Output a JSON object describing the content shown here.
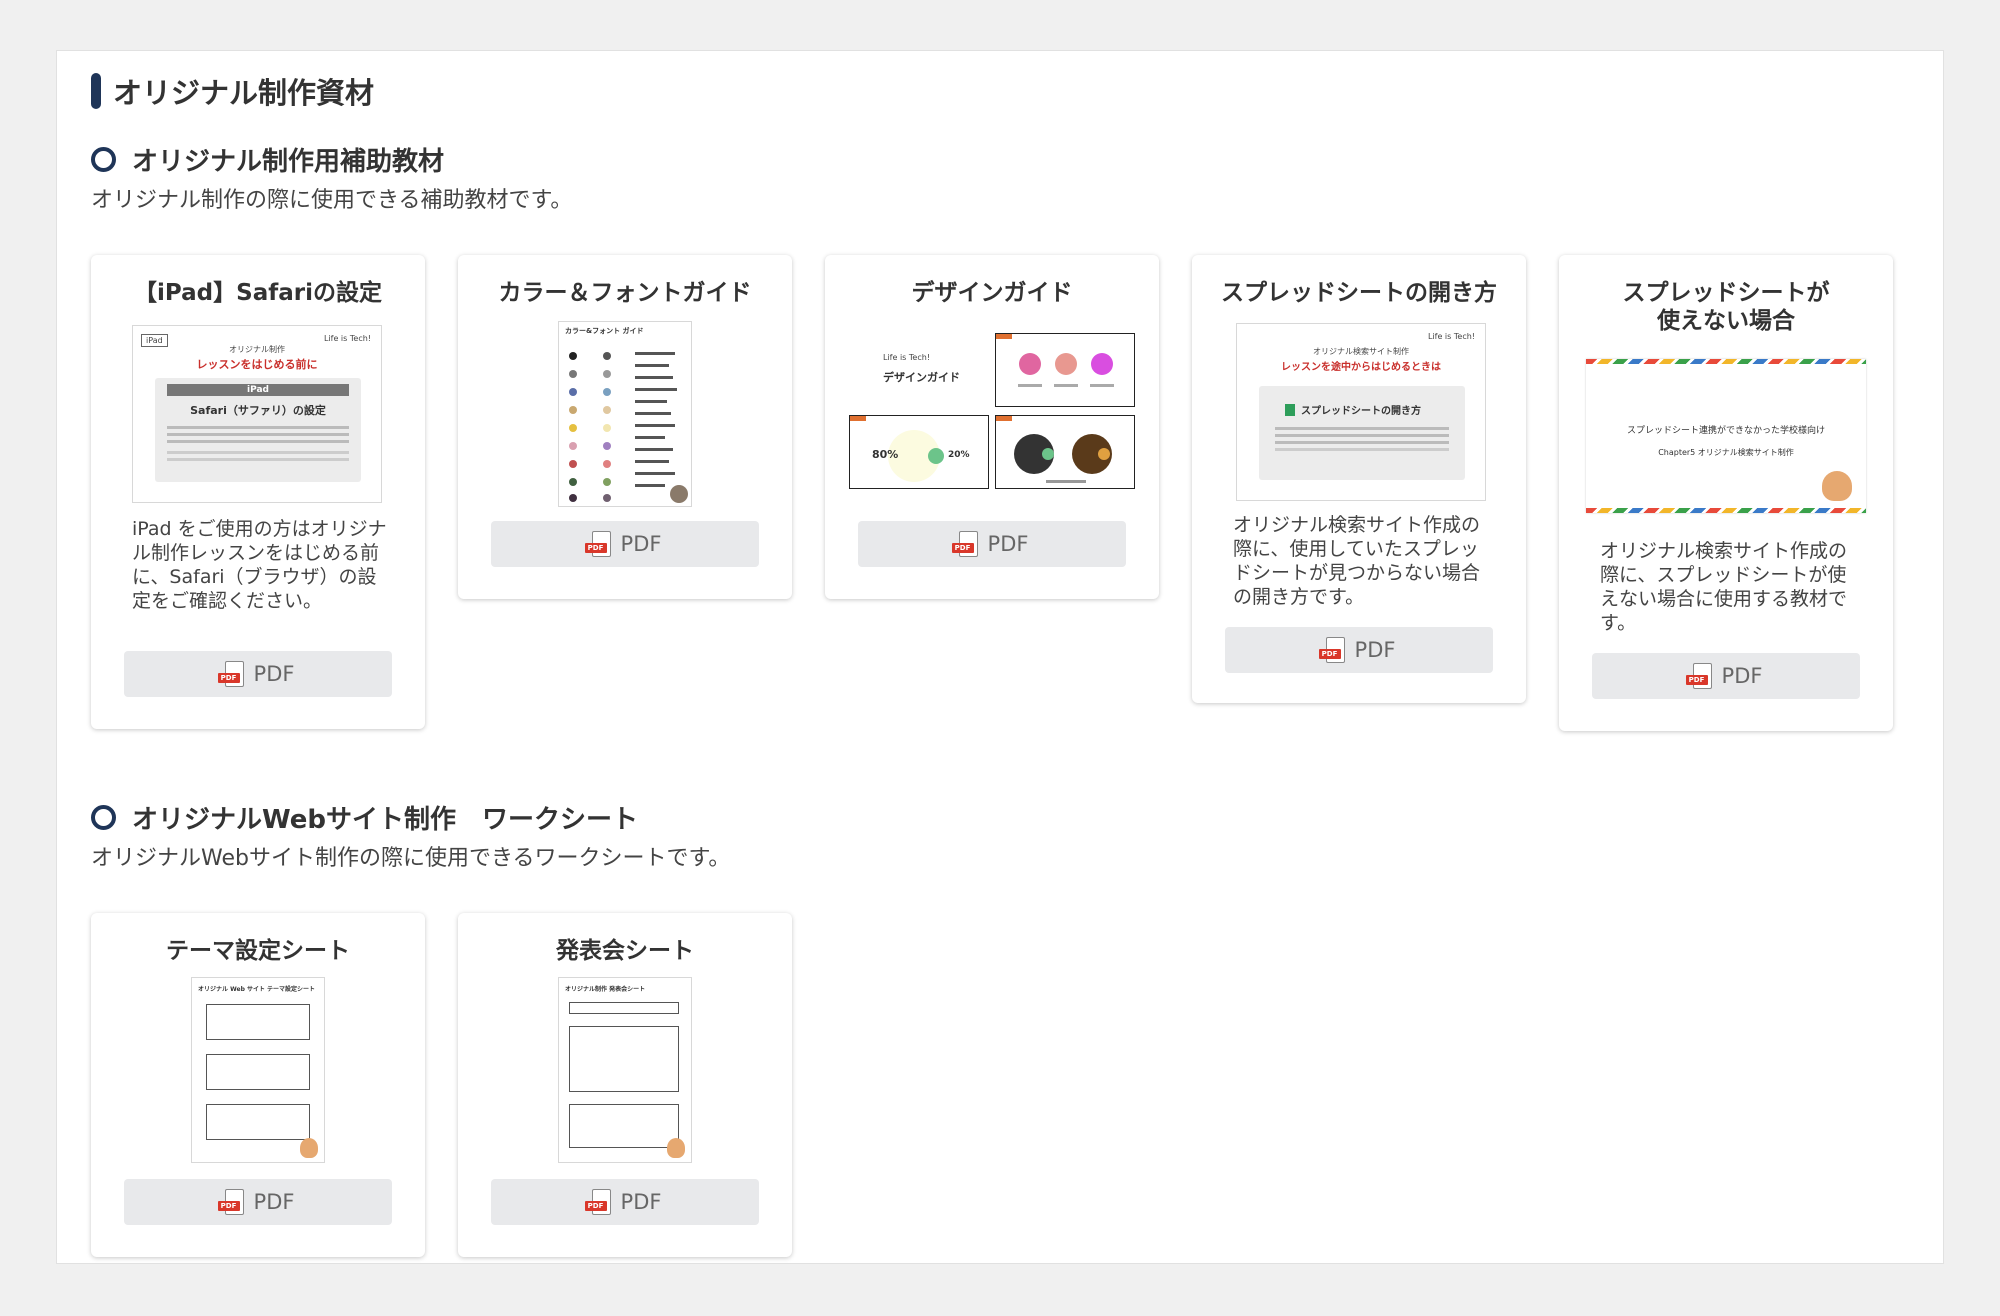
{
  "page": {
    "title": "オリジナル制作資材"
  },
  "sections": [
    {
      "heading": "オリジナル制作用補助教材",
      "description": "オリジナル制作の際に使用できる補助教材です。",
      "cards": [
        {
          "title": "【iPad】Safariの設定",
          "description": "iPad をご使用の方はオリジナル制作レッスンをはじめる前に、Safari（ブラウザ）の設定をご確認ください。",
          "button": "PDF",
          "thumb": {
            "tag": "iPad",
            "sub": "オリジナル制作",
            "red": "レッスンをはじめる前に",
            "band": "iPad",
            "main": "Safari（サファリ）の設定",
            "logo": "Life is Tech!"
          }
        },
        {
          "title": "カラー＆フォントガイド",
          "description": "",
          "button": "PDF",
          "thumb": {
            "head": "カラー&フォント ガイド"
          }
        },
        {
          "title": "デザインガイド",
          "description": "",
          "button": "PDF",
          "thumb": {
            "logo": "Life is Tech!",
            "main": "デザインガイド",
            "p1": "80%",
            "p2": "20%"
          }
        },
        {
          "title": "スプレッドシートの開き方",
          "description": "オリジナル検索サイト作成の際に、使用していたスプレッドシートが見つからない場合の開き方です。",
          "button": "PDF",
          "thumb": {
            "sub": "オリジナル検索サイト制作",
            "red": "レッスンを途中からはじめるときは",
            "main": "スプレッドシートの開き方",
            "logo": "Life is Tech!"
          }
        },
        {
          "title_lines": [
            "スプレッドシートが",
            "使えない場合"
          ],
          "description": "オリジナル検索サイト作成の際に、スプレッドシートが使えない場合に使用する教材です。",
          "button": "PDF",
          "thumb": {
            "line1": "スプレッドシート連携ができなかった学校様向け",
            "line2": "Chapter5 オリジナル検索サイト制作"
          }
        }
      ]
    },
    {
      "heading": "オリジナルWebサイト制作　ワークシート",
      "description": "オリジナルWebサイト制作の際に使用できるワークシートです。",
      "cards": [
        {
          "title": "テーマ設定シート",
          "button": "PDF",
          "thumb": {
            "head": "オリジナル Web サイト テーマ設定シート"
          }
        },
        {
          "title": "発表会シート",
          "button": "PDF",
          "thumb": {
            "head": "オリジナル制作 発表会シート"
          }
        }
      ]
    }
  ],
  "colors": {
    "accent": "#1f3558",
    "pdf_red": "#d9372a",
    "button_bg": "#e8e9eb"
  }
}
